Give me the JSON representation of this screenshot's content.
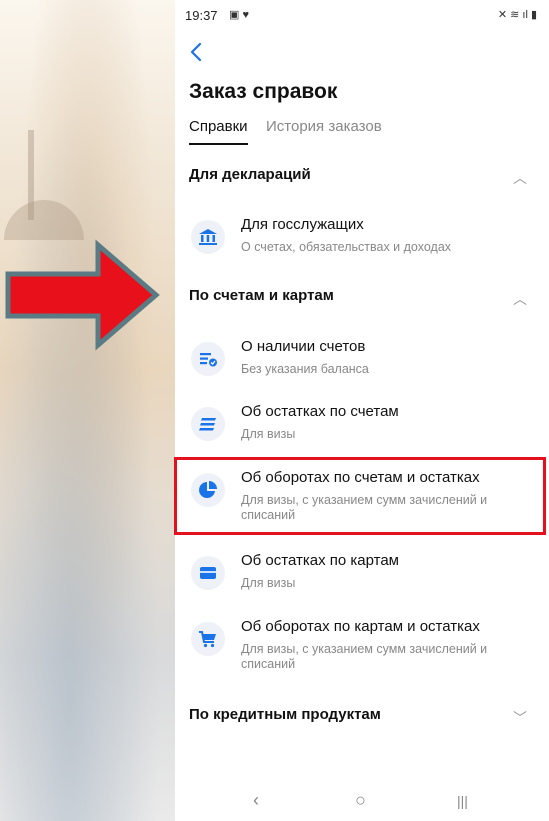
{
  "status_bar": {
    "time": "19:37",
    "left_icons": "▣ ♥",
    "right_icons": "✕ ≋ ıl ▮"
  },
  "header": {
    "title": "Заказ справок"
  },
  "tabs": [
    {
      "label": "Справки",
      "active": true
    },
    {
      "label": "История заказов",
      "active": false
    }
  ],
  "sections": [
    {
      "title": "Для деклараций",
      "expanded": true,
      "items": [
        {
          "title": "Для госслужащих",
          "subtitle": "О счетах, обязательствах и доходах",
          "icon": "bank-icon"
        }
      ]
    },
    {
      "title": "По счетам и картам",
      "expanded": true,
      "items": [
        {
          "title": "О наличии счетов",
          "subtitle": "Без указания баланса",
          "icon": "accounts-check-icon"
        },
        {
          "title": "Об остатках по счетам",
          "subtitle": "Для визы",
          "icon": "list-icon"
        },
        {
          "title": "Об оборотах по счетам и остатках",
          "subtitle": "Для визы, с указанием сумм зачислений и списаний",
          "icon": "pie-chart-icon"
        },
        {
          "title": "Об остатках по картам",
          "subtitle": "Для визы",
          "icon": "card-icon"
        },
        {
          "title": "Об оборотах по картам и остатках",
          "subtitle": "Для визы, с указанием сумм зачислений и списаний",
          "icon": "cart-icon"
        }
      ]
    },
    {
      "title": "По кредитным продуктам",
      "expanded": false,
      "items": []
    }
  ],
  "nav": {
    "back": "‹",
    "home": "○",
    "recents": "|||"
  },
  "colors": {
    "accent": "#1a73e8",
    "highlight": "#e5101d",
    "arrow": "#e8101a"
  }
}
